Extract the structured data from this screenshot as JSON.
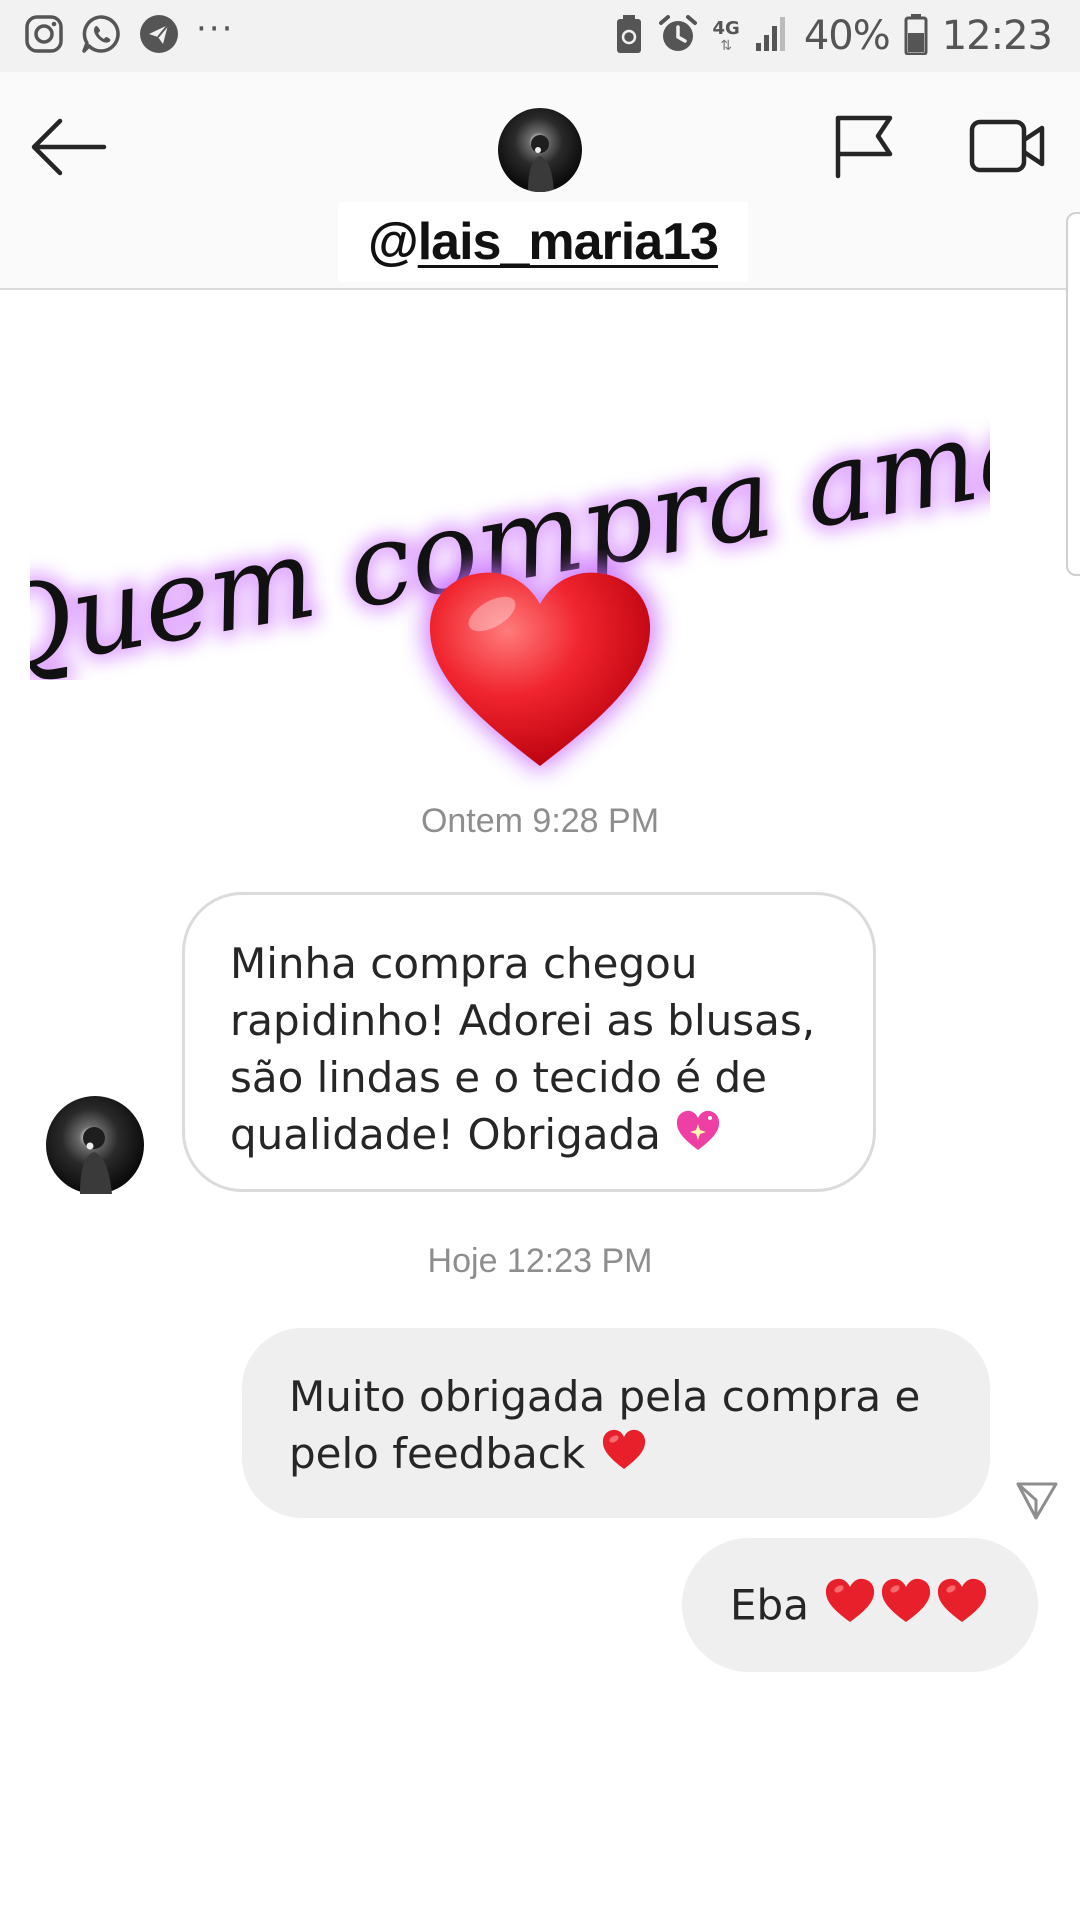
{
  "status_bar": {
    "left_icons": [
      "instagram-icon",
      "whatsapp-icon",
      "telegram-icon"
    ],
    "more_indicator": "···",
    "network_type": "4G",
    "battery_percent": "40%",
    "time": "12:23"
  },
  "header": {
    "username_prefix": "@",
    "username_handle": "lais_maria13"
  },
  "sticker": {
    "text": "Quem compra ama"
  },
  "messages": [
    {
      "timestamp": "Ontem 9:28 PM",
      "direction": "incoming",
      "text": "Minha compra chegou rapidinho! Adorei as blusas, são lindas e o tecido é de qualidade! Obrigada",
      "lines": [
        "Minha compra chegou",
        "rapidinho! Adorei as blusas,",
        "são lindas e o tecido é de",
        "qualidade! Obrigada"
      ],
      "emoji": "sparkling-heart"
    },
    {
      "timestamp": "Hoje 12:23 PM",
      "direction": "outgoing",
      "text": "Muito obrigada pela compra e pelo feedback",
      "lines": [
        "Muito obrigada pela compra e",
        "pelo feedback"
      ],
      "emoji": "red-heart"
    },
    {
      "direction": "outgoing",
      "text": "Eba",
      "emoji": "red-heart x3"
    }
  ],
  "colors": {
    "status_bar_bg": "#f2f2f2",
    "header_bg": "#fafafa",
    "outgoing_bubble": "#efefef",
    "incoming_border": "#dbdbdb",
    "timestamp": "#8e8e8e",
    "heart": "#e8202c",
    "glow": "#c86bff"
  }
}
